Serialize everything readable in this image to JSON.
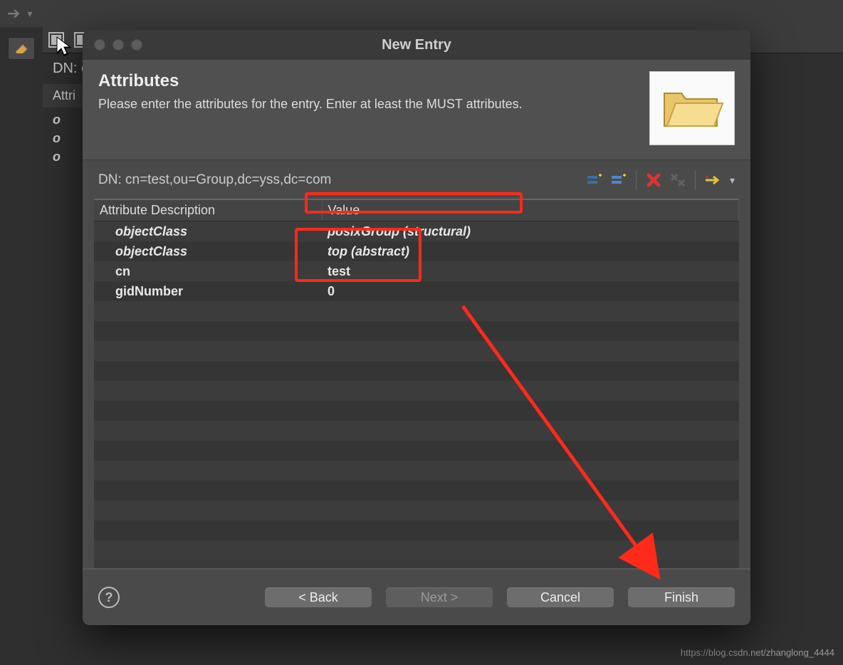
{
  "bg": {
    "dn_label": "DN: c",
    "attri_stub": "Attri",
    "stub_rows": [
      "o",
      "o",
      "o"
    ]
  },
  "dialog": {
    "title": "New Entry",
    "heading": "Attributes",
    "subtitle": "Please enter the attributes for the entry. Enter at least the MUST attributes.",
    "dn": "DN: cn=test,ou=Group,dc=yss,dc=com",
    "columns": {
      "attr": "Attribute Description",
      "value": "Value"
    },
    "rows": [
      {
        "attr": "objectClass",
        "value": "posixGroup (structural)",
        "italic": true
      },
      {
        "attr": "objectClass",
        "value": "top (abstract)",
        "italic": true
      },
      {
        "attr": "cn",
        "value": "test",
        "italic": false
      },
      {
        "attr": "gidNumber",
        "value": "0",
        "italic": false
      }
    ],
    "buttons": {
      "back": "< Back",
      "next": "Next >",
      "cancel": "Cancel",
      "finish": "Finish"
    }
  },
  "watermark": "https://blog.csdn.net/zhanglong_4444"
}
